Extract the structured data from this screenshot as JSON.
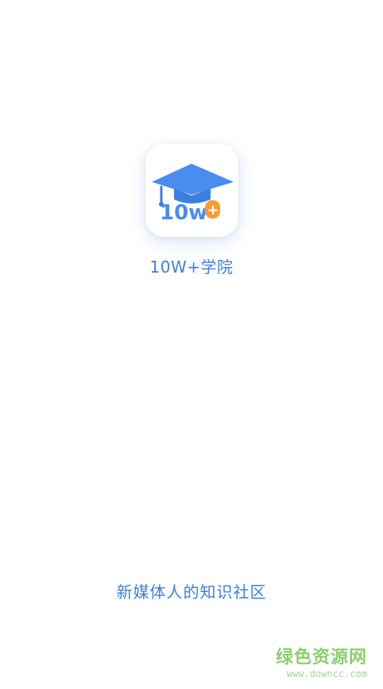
{
  "app": {
    "name": "10W+学院",
    "logo_text_left": "10w",
    "logo_text_right": "+",
    "slogan": "新媒体人的知识社区"
  },
  "watermark": {
    "main": "绿色资源网",
    "sub": "www.downcc.com"
  },
  "colors": {
    "brand_blue": "#3d7fe0",
    "cap_blue": "#4a8cf0",
    "accent_orange": "#ff9a2e",
    "watermark_green": "#8ccf6e"
  }
}
